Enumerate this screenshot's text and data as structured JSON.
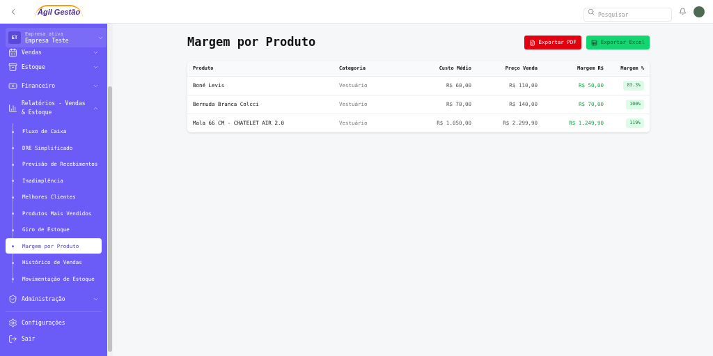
{
  "header": {
    "logo": "Ágil Gestão",
    "search": {
      "placeholder": "Pesquisar"
    }
  },
  "company": {
    "initials": "ET",
    "caption": "Empresa ativa",
    "name": "Empresa Teste"
  },
  "sidebar": {
    "items": [
      {
        "kind": "group",
        "label": "Vendas",
        "expanded": false
      },
      {
        "kind": "group",
        "label": "Estoque",
        "expanded": false
      },
      {
        "kind": "group",
        "label": "Financeiro",
        "expanded": false
      },
      {
        "kind": "group",
        "label": "Relatórios - Vendas & Estoque",
        "expanded": true,
        "children": [
          {
            "label": "Fluxo de Caixa",
            "selected": false
          },
          {
            "label": "DRE Simplificado",
            "selected": false
          },
          {
            "label": "Previsão de Recebimentos",
            "selected": false
          },
          {
            "label": "Inadimplência",
            "selected": false
          },
          {
            "label": "Melhores Clientes",
            "selected": false
          },
          {
            "label": "Produtos Mais Vendidos",
            "selected": false
          },
          {
            "label": "Giro de Estoque",
            "selected": false
          },
          {
            "label": "Margem por Produto",
            "selected": true
          },
          {
            "label": "Histórico de Vendas",
            "selected": false
          },
          {
            "label": "Movimentação de Estoque",
            "selected": false
          }
        ]
      },
      {
        "kind": "group",
        "label": "Administração",
        "expanded": false
      },
      {
        "kind": "divider"
      },
      {
        "kind": "link",
        "label": "Configurações"
      },
      {
        "kind": "link",
        "label": "Sair"
      }
    ]
  },
  "page": {
    "title": "Margem por Produto",
    "buttons": [
      {
        "kind": "pdf",
        "label": "Exportar PDF"
      },
      {
        "kind": "excel",
        "label": "Exportar Excel"
      }
    ]
  },
  "table": {
    "columns": [
      "Produto",
      "Categoria",
      "Custo Médio",
      "Preço Venda",
      "Margem R$",
      "Margem %"
    ],
    "rows": [
      [
        "Boné Levis",
        "Vestuário",
        "R$ 60,00",
        "R$ 110,00",
        "R$ 50,00",
        "83.3%"
      ],
      [
        "Bermuda Branca Colcci",
        "Vestuário",
        "R$ 70,00",
        "R$ 140,00",
        "R$ 70,00",
        "100%"
      ],
      [
        "Mala 66 CM - CHATELET AIR 2.0",
        "Vestuário",
        "R$ 1.050,00",
        "R$ 2.299,90",
        "R$ 1.249,90",
        "119%"
      ]
    ]
  }
}
